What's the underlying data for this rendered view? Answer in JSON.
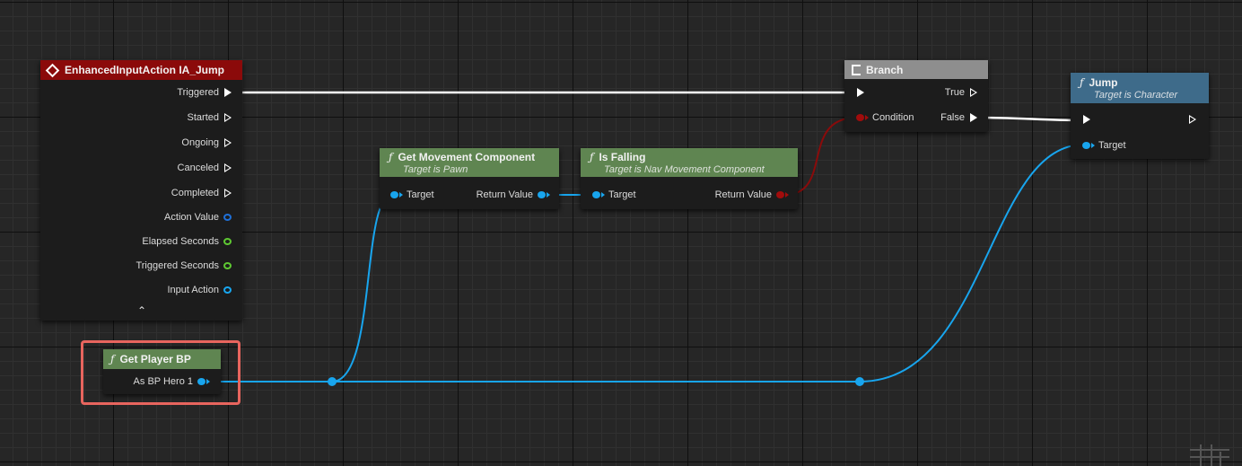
{
  "ia_jump": {
    "title": "EnhancedInputAction IA_Jump",
    "header_color": "#8b0a0a",
    "outputs": {
      "triggered": "Triggered",
      "started": "Started",
      "ongoing": "Ongoing",
      "canceled": "Canceled",
      "completed": "Completed",
      "action_value": "Action Value",
      "elapsed_seconds": "Elapsed Seconds",
      "triggered_seconds": "Triggered Seconds",
      "input_action": "Input Action"
    }
  },
  "get_movement_component": {
    "title": "Get Movement Component",
    "subtitle": "Target is Pawn",
    "header_color": "#5f8551",
    "input_target": "Target",
    "output_return": "Return Value"
  },
  "is_falling": {
    "title": "Is Falling",
    "subtitle": "Target is Nav Movement Component",
    "header_color": "#5f8551",
    "input_target": "Target",
    "output_return": "Return Value"
  },
  "branch": {
    "title": "Branch",
    "header_color": "#8e8e8e",
    "input_condition": "Condition",
    "output_true": "True",
    "output_false": "False"
  },
  "jump": {
    "title": "Jump",
    "subtitle": "Target is Character",
    "header_color": "#3e6b8a",
    "input_target": "Target"
  },
  "get_player_bp": {
    "title": "Get Player BP",
    "header_color": "#5f8551",
    "output": "As BP Hero 1"
  },
  "colors": {
    "exec_wire": "#ffffff",
    "object_wire": "#18a5ee",
    "bool_wire": "#8a0b0b",
    "selection_outline": "#e8655e"
  }
}
